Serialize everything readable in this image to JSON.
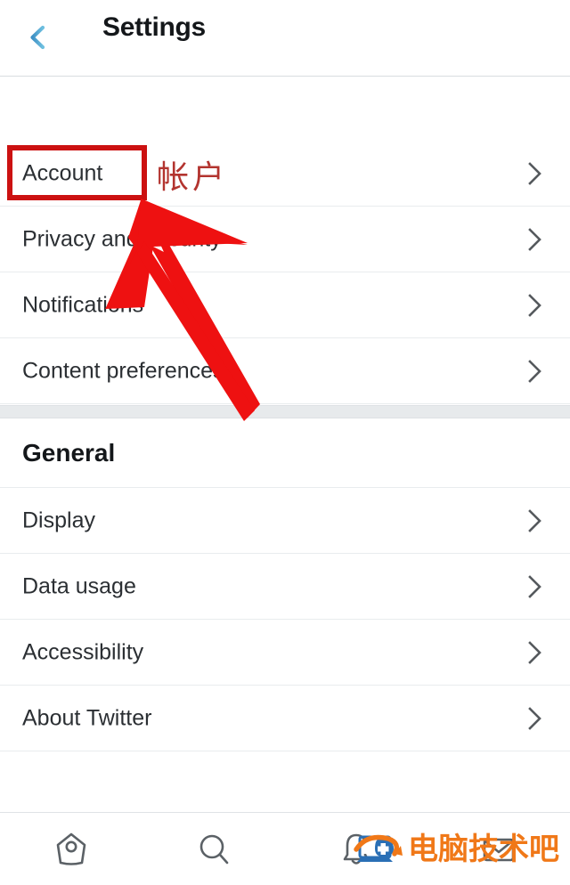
{
  "header": {
    "title": "Settings",
    "back_icon": "back-arrow-icon",
    "back_color": "#4a9fd4"
  },
  "sections": [
    {
      "id": "account-section",
      "title": null,
      "rows": [
        {
          "label": "Account",
          "chevron": "chevron-right-icon"
        },
        {
          "label": "Privacy and security",
          "chevron": "chevron-right-icon"
        },
        {
          "label": "Notifications",
          "chevron": "chevron-right-icon"
        },
        {
          "label": "Content preferences",
          "chevron": "chevron-right-icon"
        }
      ]
    },
    {
      "id": "general-section",
      "title": "General",
      "rows": [
        {
          "label": "Display",
          "chevron": "chevron-right-icon"
        },
        {
          "label": "Data usage",
          "chevron": "chevron-right-icon"
        },
        {
          "label": "Accessibility",
          "chevron": "chevron-right-icon"
        },
        {
          "label": "About Twitter",
          "chevron": "chevron-right-icon"
        }
      ]
    }
  ],
  "annotations": {
    "highlight_box_color": "#cc1111",
    "arrow_color": "#ee1111",
    "translation_text": "帐户",
    "translation_color": "#b3342f"
  },
  "bottom_nav": [
    {
      "label": "Home",
      "icon": "home-icon"
    },
    {
      "label": "Search",
      "icon": "search-icon"
    },
    {
      "label": "Notifications",
      "icon": "bell-icon"
    },
    {
      "label": "Messages",
      "icon": "envelope-icon"
    }
  ],
  "watermark": {
    "text": "电脑技术吧",
    "color": "#f07818",
    "logo_icon": "computer-repair-logo-icon",
    "logo_color": "#2a6fb5"
  }
}
